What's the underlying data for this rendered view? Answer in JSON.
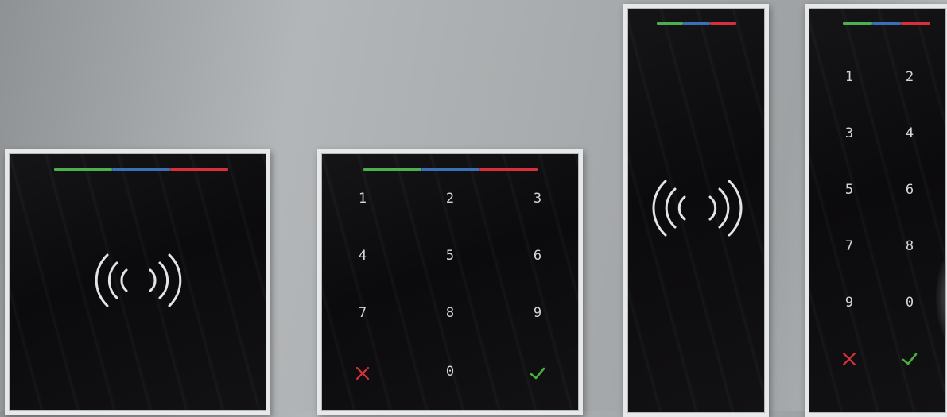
{
  "colors": {
    "led_green": "#4caf50",
    "led_blue": "#3b6fb6",
    "led_red": "#d8303a",
    "key_cancel": "#d8333b",
    "key_confirm": "#45b23c",
    "key_text": "#d6d6d8"
  },
  "devices": [
    {
      "type": "card-reader",
      "icons": [
        "led-bar",
        "nfc-icon"
      ]
    },
    {
      "type": "keypad-reader",
      "keys": [
        {
          "label": "1"
        },
        {
          "label": "2"
        },
        {
          "label": "3"
        },
        {
          "label": "4"
        },
        {
          "label": "5"
        },
        {
          "label": "6"
        },
        {
          "label": "7"
        },
        {
          "label": "8"
        },
        {
          "label": "9"
        },
        {
          "icon": "cancel-x-icon"
        },
        {
          "label": "0"
        },
        {
          "icon": "confirm-check-icon"
        }
      ]
    },
    {
      "type": "card-reader-tall",
      "icons": [
        "led-bar",
        "nfc-icon"
      ]
    },
    {
      "type": "keypad-reader-tall",
      "keys": [
        {
          "label": "1"
        },
        {
          "label": "2"
        },
        {
          "label": "3"
        },
        {
          "label": "4"
        },
        {
          "label": "5"
        },
        {
          "label": "6"
        },
        {
          "label": "7"
        },
        {
          "label": "8"
        },
        {
          "label": "9"
        },
        {
          "label": "0"
        },
        {
          "icon": "cancel-x-icon"
        },
        {
          "icon": "confirm-check-icon"
        }
      ]
    }
  ]
}
